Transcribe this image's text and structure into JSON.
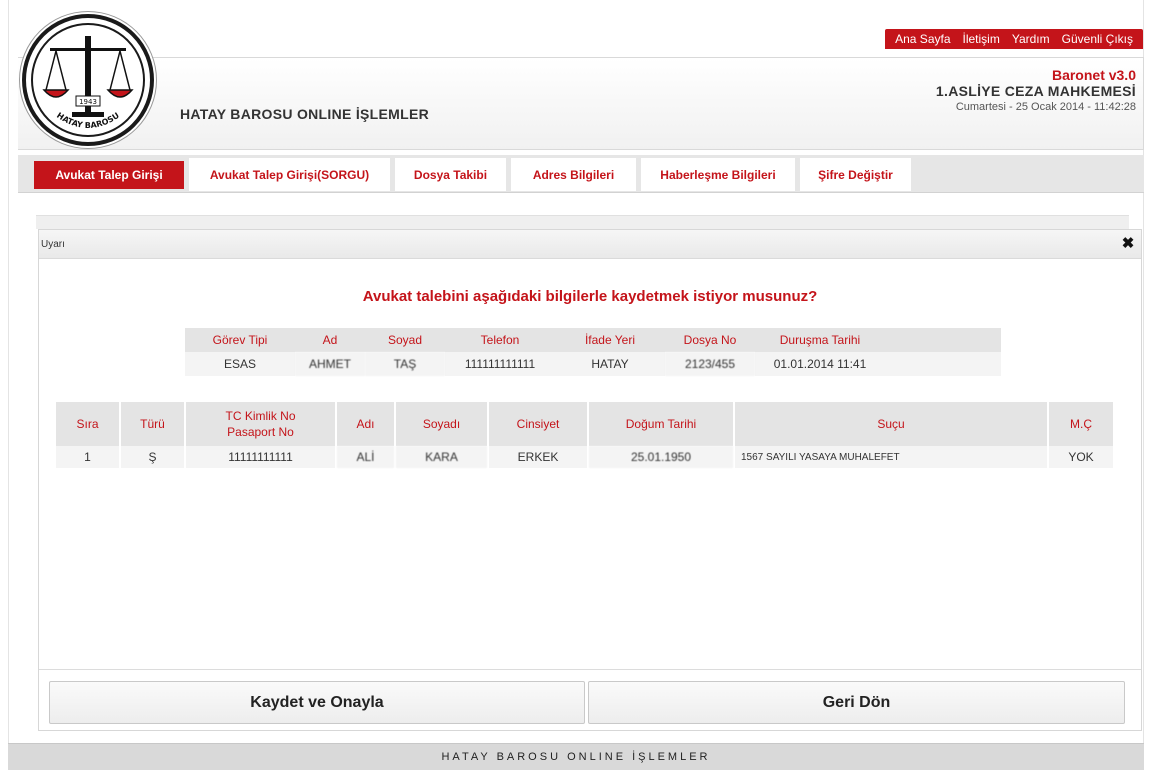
{
  "header": {
    "top_links": [
      "Ana Sayfa",
      "İletişim",
      "Yardım",
      "Güvenli Çıkış"
    ],
    "site_title": "HATAY BAROSU ONLINE İŞLEMLER",
    "version": "Baronet v3.0",
    "court": "1.ASLİYE CEZA MAHKEMESİ",
    "datetime": "Cumartesi - 25 Ocak 2014 - 11:42:28",
    "logo_text": "HATAY BAROSU",
    "logo_year": "1943"
  },
  "nav": {
    "tabs": [
      {
        "label": "Avukat Talep Girişi",
        "active": true
      },
      {
        "label": "Avukat Talep Girişi(SORGU)",
        "active": false
      },
      {
        "label": "Dosya Takibi",
        "active": false
      },
      {
        "label": "Adres Bilgileri",
        "active": false
      },
      {
        "label": "Haberleşme Bilgileri",
        "active": false
      },
      {
        "label": "Şifre Değiştir",
        "active": false
      }
    ]
  },
  "dialog": {
    "title": "Uyarı",
    "close_symbol": "✖",
    "question": "Avukat talebini aşağıdaki bilgilerle kaydetmek istiyor musunuz?",
    "request_table": {
      "headers": [
        "Görev Tipi",
        "Ad",
        "Soyad",
        "Telefon",
        "İfade Yeri",
        "Dosya No",
        "Duruşma Tarihi"
      ],
      "row": [
        "ESAS",
        "AHMET",
        "TAŞ",
        "111111111111",
        "HATAY",
        "2123/455",
        "01.01.2014 11:41"
      ]
    },
    "person_table": {
      "headers": [
        "Sıra",
        "Türü",
        "TC Kimlik No",
        "Pasaport No",
        "Adı",
        "Soyadı",
        "Cinsiyet",
        "Doğum Tarihi",
        "Suçu",
        "M.Ç"
      ],
      "row": [
        "1",
        "Ş",
        "11111111111",
        "ALİ",
        "KARA",
        "ERKEK",
        "25.01.1950",
        "1567 SAYILI YASAYA MUHALEFET",
        "YOK"
      ]
    },
    "buttons": {
      "save": "Kaydet ve Onayla",
      "back": "Geri Dön"
    }
  },
  "footer": {
    "text": "HATAY BAROSU ONLINE İŞLEMLER"
  },
  "colors": {
    "accent": "#c4141a",
    "header_bg": "#e6e6e6"
  }
}
